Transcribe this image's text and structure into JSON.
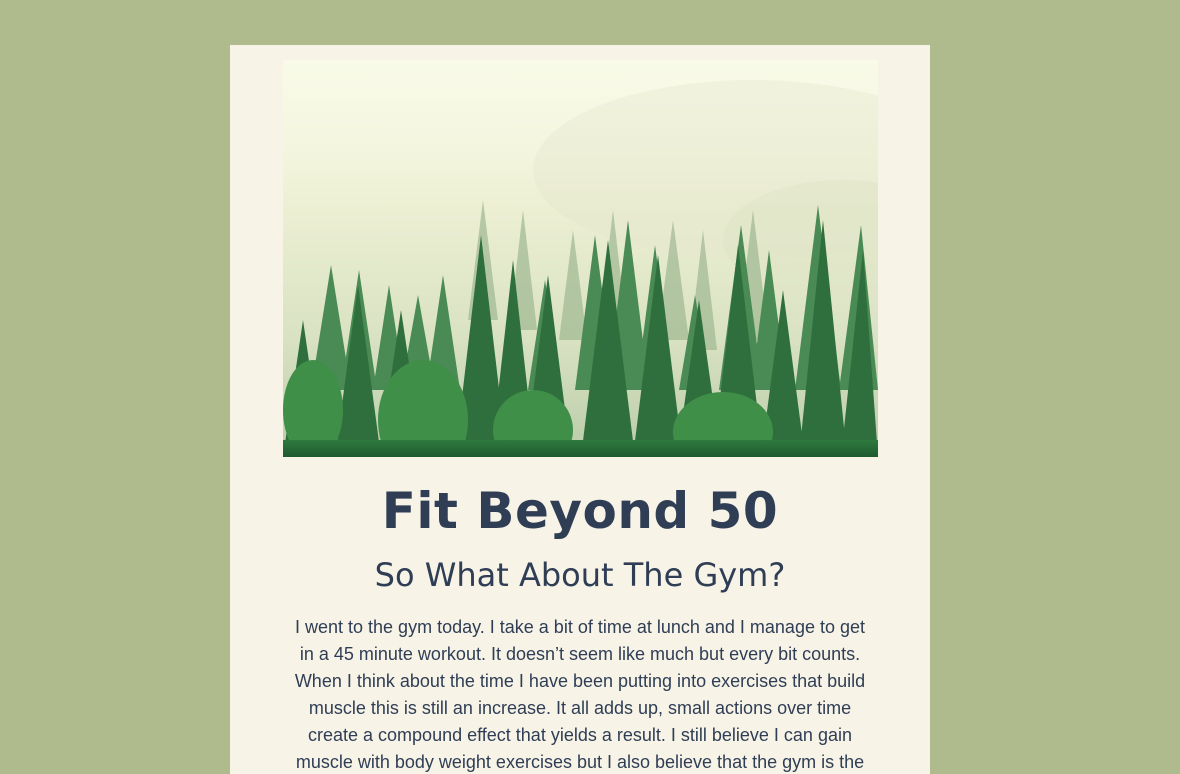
{
  "page": {
    "background_color": "#afba8d",
    "card_color": "#f7f3e7",
    "text_color": "#2f3e55"
  },
  "hero": {
    "icon": "misty-forest-photo"
  },
  "header": {
    "title": "Fit Beyond 50",
    "subtitle": "So What About The Gym?"
  },
  "article": {
    "body": "I went to the gym today. I take a bit of time at lunch and I manage to get in a 45 minute workout. It doesn’t seem like much but every bit counts. When I think about the time I have been putting into exercises that build muscle this is still an increase. It all adds up, small actions over time create a compound effect that yields a result. I still believe I can gain muscle with body weight exercises but I also believe that the gym is the"
  }
}
